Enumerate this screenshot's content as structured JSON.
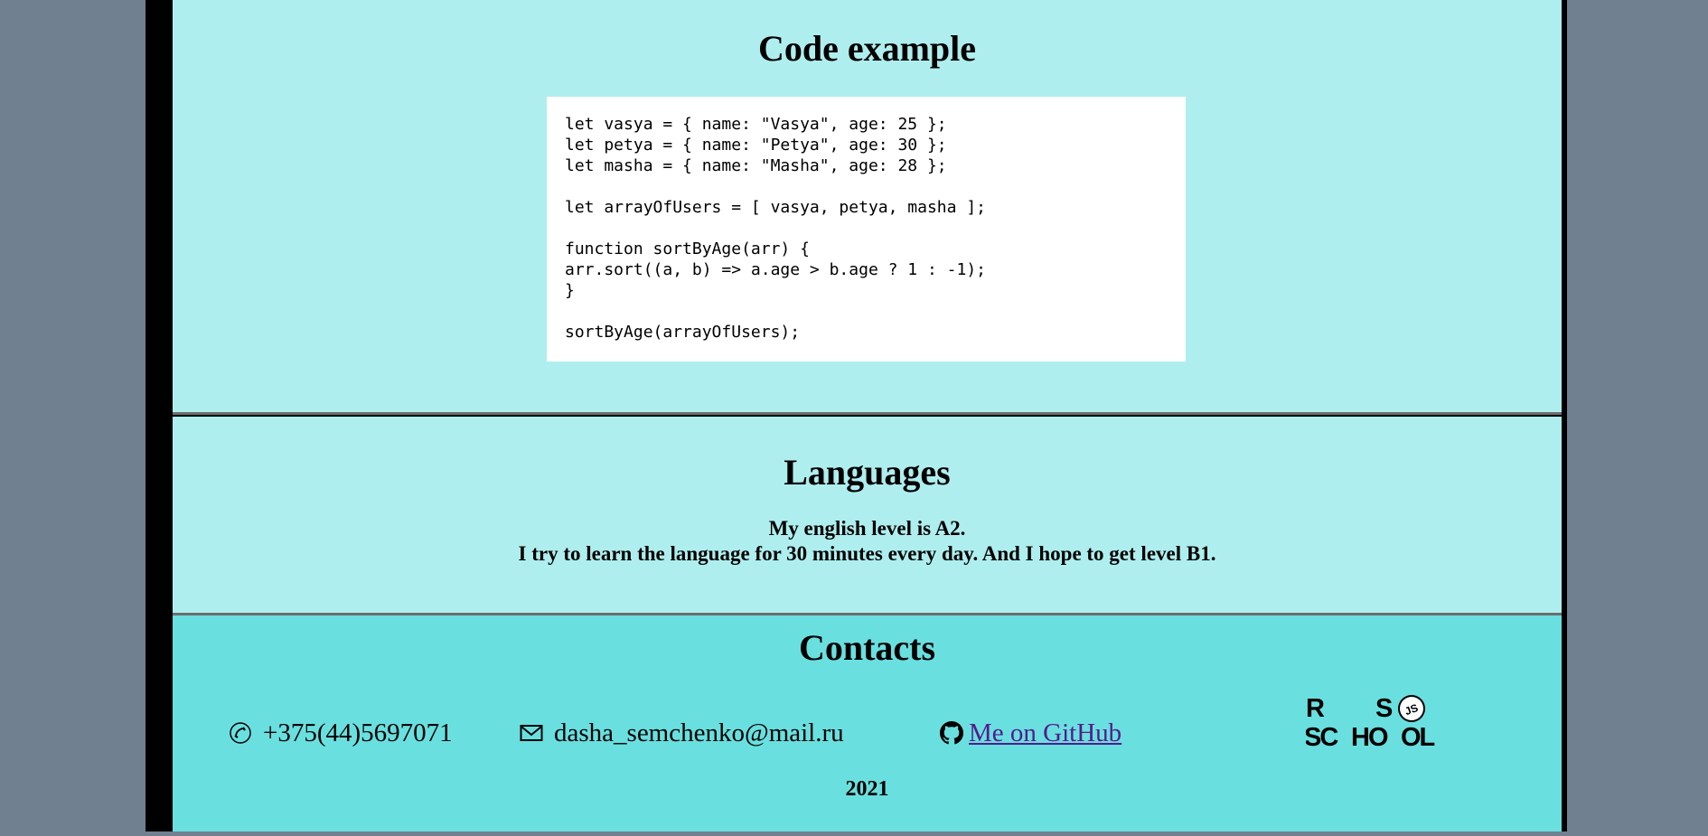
{
  "code_section": {
    "title": "Code example",
    "lines": [
      "let vasya = { name: \"Vasya\", age: 25 };",
      "let petya = { name: \"Petya\", age: 30 };",
      "let masha = { name: \"Masha\", age: 28 };",
      "",
      "let arrayOfUsers = [ vasya, petya, masha ];",
      "",
      "function sortByAge(arr) {",
      "arr.sort((a, b) => a.age > b.age ? 1 : -1);",
      "}",
      "",
      "sortByAge(arrayOfUsers);"
    ]
  },
  "languages": {
    "title": "Languages",
    "line1": "My english level is A2.",
    "line2": "I try to learn the language for 30 minutes every day. And I hope to get level B1."
  },
  "contacts": {
    "title": "Contacts",
    "phone": "+375(44)5697071",
    "email": "dasha_semchenko@mail.ru",
    "github_label": "Me on GitHub",
    "year": "2021"
  },
  "logo": {
    "text_r": "R",
    "text_s": "S",
    "text_sc": "SC",
    "text_ho": "HO",
    "text_ol": "OL",
    "badge": "JS"
  },
  "icons": {
    "phone": "phone-icon",
    "email": "envelope-icon",
    "github": "github-icon"
  },
  "colors": {
    "page_background": "#708090",
    "section_background": "#afeeee",
    "contacts_background": "#6adfdf",
    "link": "#551a8b"
  }
}
